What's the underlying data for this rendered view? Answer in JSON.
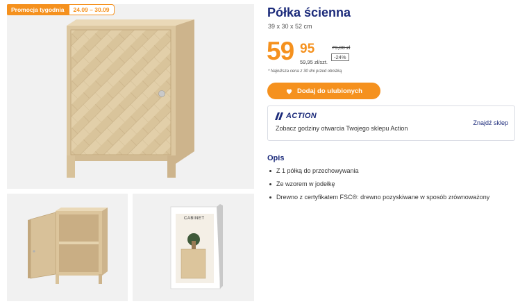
{
  "promo": {
    "label": "Promocja tygodnia",
    "dates": "24.09 – 30.09"
  },
  "product": {
    "title": "Półka ścienna",
    "dimensions": "39 x 30 x 52 cm"
  },
  "price": {
    "main": "59",
    "cents": "95",
    "old": "79,00 zł",
    "discount": "-24%",
    "unit": "59,95 zł/szt.",
    "note": "* Najniższa cena z 30 dni przed obniżką"
  },
  "favorite_button": {
    "label": "Dodaj do ulubionych",
    "icon": "heart-icon"
  },
  "store": {
    "logo": "ACTION",
    "description": "Zobacz godziny otwarcia Twojego sklepu Action",
    "link": "Znajdź sklep"
  },
  "description": {
    "title": "Opis",
    "items": [
      "Z 1 półką do przechowywania",
      "Ze wzorem w jodełkę",
      "Drewno z certyfikatem FSC®: drewno pozyskiwane w sposób zrównoważony"
    ]
  },
  "packaging": {
    "label": "CABINET"
  },
  "colors": {
    "accent": "#f5911e",
    "brand": "#1b2a7a",
    "image_bg": "#f1f1f1"
  }
}
